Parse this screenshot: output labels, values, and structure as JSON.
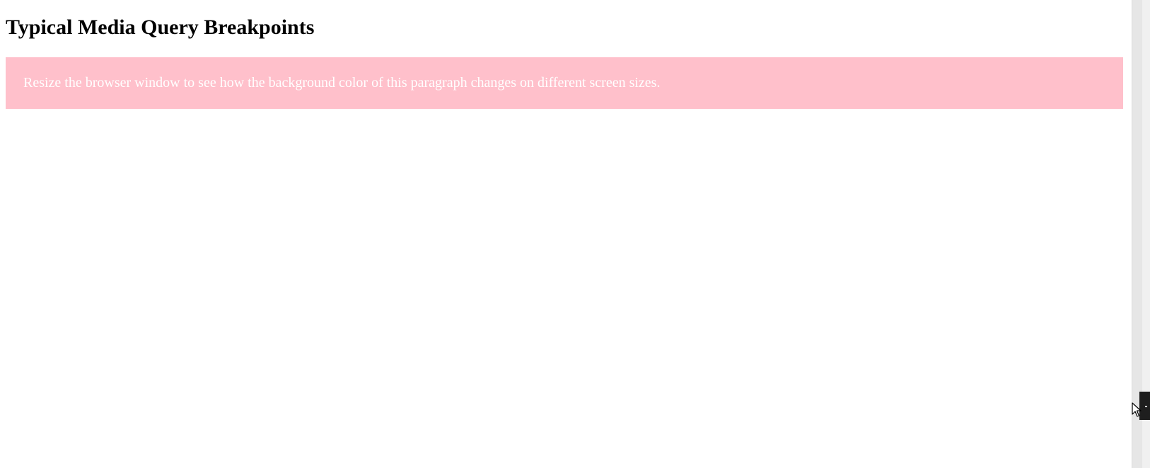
{
  "page": {
    "title": "Typical Media Query Breakpoints",
    "paragraph": "Resize the browser window to see how the background color of this paragraph changes on different screen sizes."
  },
  "colors": {
    "paragraph_background": "#ffc0cb",
    "paragraph_text": "#ffffff",
    "page_background": "#ffffff"
  },
  "icons": {
    "cursor": "mouse-pointer-icon",
    "splitter": "drag-handle-icon"
  }
}
